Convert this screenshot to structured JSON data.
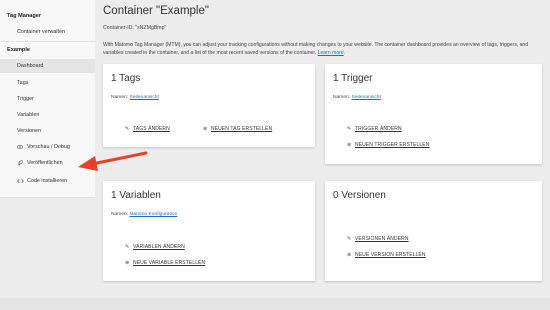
{
  "sidebar": {
    "section1": "Tag Manager",
    "section1_items": [
      {
        "label": "Container verwalten"
      }
    ],
    "section2": "Example",
    "section2_items": [
      {
        "label": "Dashboard",
        "active": true
      },
      {
        "label": "Tags"
      },
      {
        "label": "Trigger"
      },
      {
        "label": "Variablen"
      },
      {
        "label": "Versionen"
      },
      {
        "label": "Vorschau / Debug",
        "icon": "eye-icon"
      },
      {
        "label": "Veröffentlichen",
        "icon": "rocket-icon"
      },
      {
        "label": "Code installieren",
        "icon": "code-icon"
      }
    ]
  },
  "main": {
    "title": "Container \"Example\"",
    "container_id": "Container-ID: \"sNZMgBmp\"",
    "intro": "With Matomo Tag Manager (MTM), you can adjust your tracking configurations without making changes to your website. The container dashboard provides an overview of tags, triggers, and variables created in the container, and a list of the most recent saved versions of the container.",
    "intro_link": "Learn more",
    "intro_end": "."
  },
  "cards": {
    "tags": {
      "title": "1 Tags",
      "names_label": "Namen:",
      "names_link": "Seitenansicht",
      "edit_label": "TAGS ÄNDERN",
      "create_label": "NEUEN TAG ERSTELLEN"
    },
    "trigger": {
      "title": "1 Trigger",
      "names_label": "Namen:",
      "names_link": "Seitenansicht",
      "edit_label": "TRIGGER ÄNDERN",
      "create_label": "NEUEN TRIGGER ERSTELLEN"
    },
    "variables": {
      "title": "1 Variablen",
      "names_label": "Namen:",
      "names_link": "Matomo Konfiguration",
      "edit_label": "VARIABLEN ÄNDERN",
      "create_label": "NEUE VARIABLE ERSTELLEN"
    },
    "versions": {
      "title": "0 Versionen",
      "edit_label": "VERSIONEN ÄNDERN",
      "create_label": "NEUE VERSION ERSTELLEN"
    }
  },
  "colors": {
    "link": "#1a6fc7",
    "arrow": "#e8402a",
    "background": "#ececec"
  }
}
